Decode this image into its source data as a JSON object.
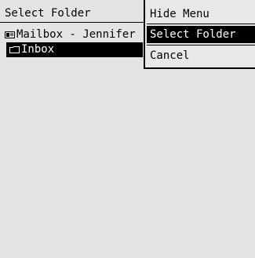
{
  "screen": {
    "title": "Select Folder"
  },
  "tree": {
    "items": [
      {
        "label": "Mailbox - Jennifer",
        "icon": "mailbox-icon",
        "selected": false
      },
      {
        "label": "Inbox",
        "icon": "folder-icon",
        "selected": true
      }
    ]
  },
  "menu": {
    "items": [
      {
        "label": "Hide Menu",
        "selected": false
      },
      {
        "label": "Select Folder",
        "selected": true
      },
      {
        "label": "Cancel",
        "selected": false
      }
    ]
  },
  "colors": {
    "background": "#e4e4e4",
    "highlight": "#000000",
    "highlight_text": "#ffffff"
  }
}
